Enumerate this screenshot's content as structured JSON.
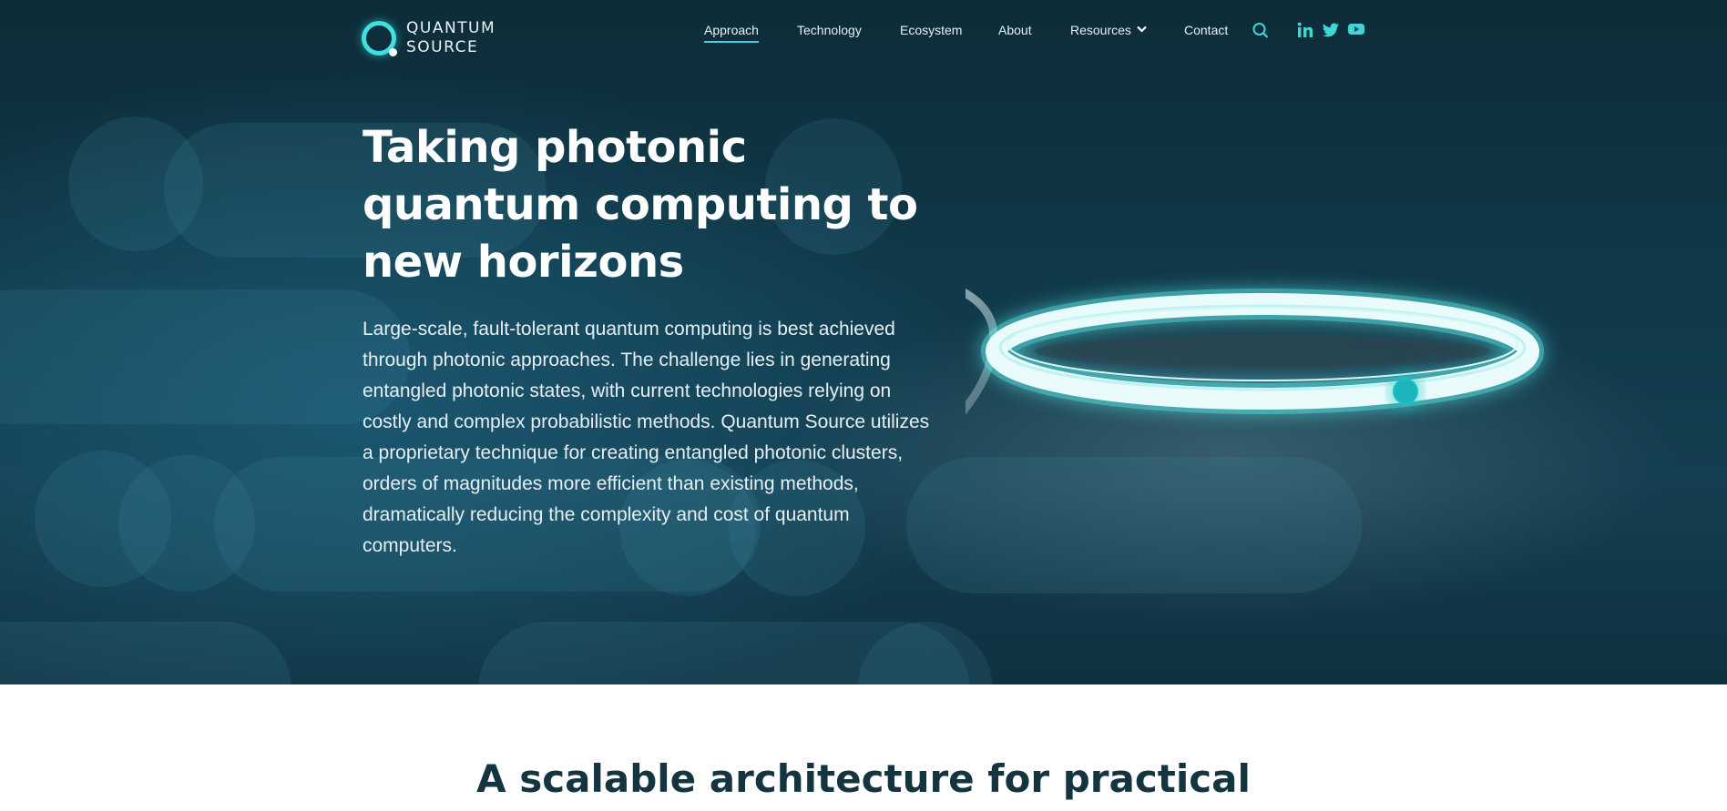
{
  "brand": {
    "line1": "QUANTUM",
    "line2": "SOURCE",
    "icon": "ring-logo-icon",
    "accent": "#3fe0e0"
  },
  "nav": {
    "items": [
      {
        "label": "Approach",
        "active": true
      },
      {
        "label": "Technology"
      },
      {
        "label": "Ecosystem"
      },
      {
        "label": "About"
      },
      {
        "label": "Resources",
        "dropdown": true
      },
      {
        "label": "Contact"
      }
    ],
    "icons": [
      "search-icon",
      "linkedin-icon",
      "twitter-icon",
      "youtube-icon"
    ]
  },
  "hero": {
    "title": "Taking photonic quantum computing to new horizons",
    "body": "Large-scale, fault-tolerant quantum computing is best achieved through photonic approaches. The challenge lies in generating entangled photonic states, with current technologies relying on costly and complex probabilistic methods. Quantum Source utilizes a proprietary technique for creating entangled photonic clusters, orders of magnitudes more efficient than existing methods, dramatically reducing the complexity and cost of quantum computers.",
    "background": "#103a4a"
  },
  "section": {
    "title": "A scalable architecture for practical",
    "color": "#143540"
  }
}
